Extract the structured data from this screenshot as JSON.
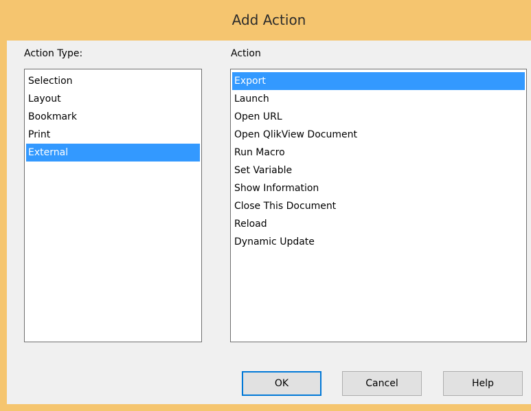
{
  "dialog": {
    "title": "Add Action"
  },
  "action_type": {
    "label": "Action Type:",
    "items": [
      "Selection",
      "Layout",
      "Bookmark",
      "Print",
      "External"
    ],
    "selected": "External"
  },
  "action": {
    "label": "Action",
    "items": [
      "Export",
      "Launch",
      "Open URL",
      "Open QlikView Document",
      "Run Macro",
      "Set Variable",
      "Show Information",
      "Close This Document",
      "Reload",
      "Dynamic Update"
    ],
    "selected": "Export"
  },
  "buttons": {
    "ok": "OK",
    "cancel": "Cancel",
    "help": "Help"
  },
  "colors": {
    "frame": "#f5c56f",
    "selection": "#3399ff",
    "default_button_border": "#0078d7"
  }
}
